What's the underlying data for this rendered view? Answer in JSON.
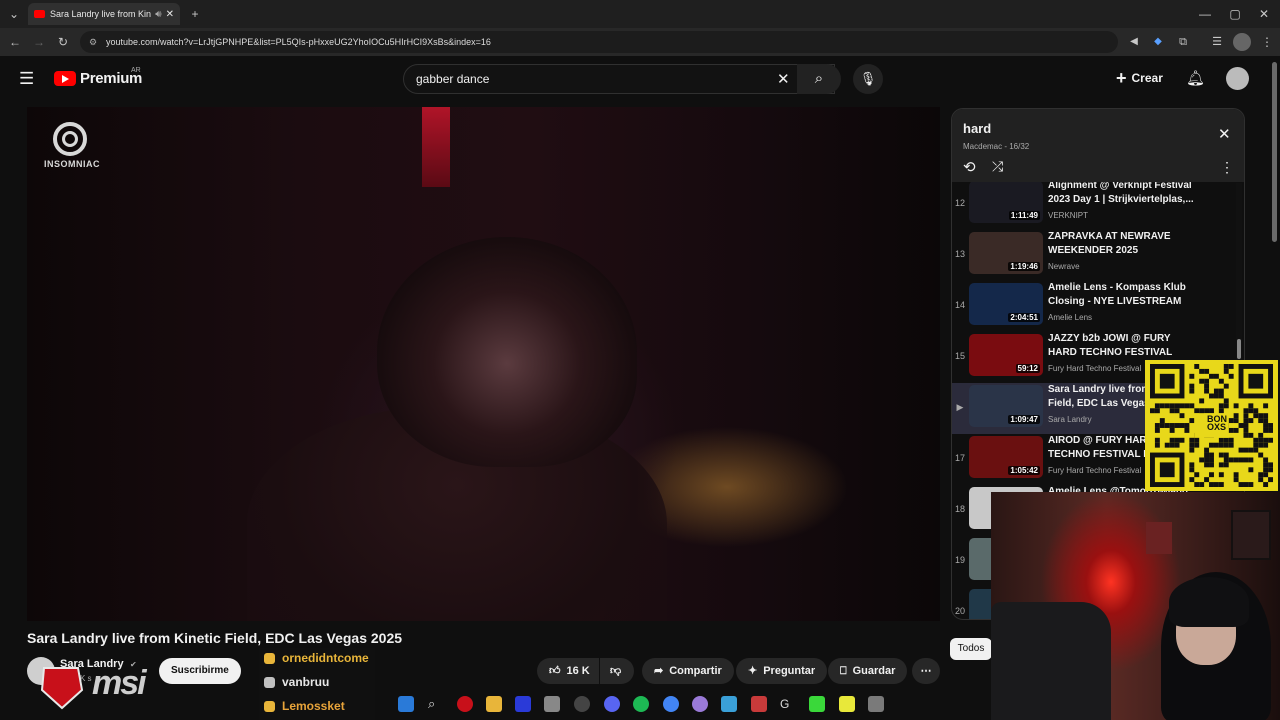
{
  "browser": {
    "tab_title": "Sara Landry live from Kinetic",
    "url": "youtube.com/watch?v=LrJtjGPNHPE&list=PL5QIs-pHxxeUG2YhoIOCu5HIrHCI9XsBs&index=16"
  },
  "youtube": {
    "logo_text": "Premium",
    "region": "AR",
    "search_query": "gabber dance",
    "create_label": "Crear"
  },
  "video": {
    "watermark": "INSOMNIAC",
    "title": "Sara Landry live from Kinetic Field, EDC Las Vegas 2025",
    "channel": "Sara Landry",
    "subscribers_partial": "K s",
    "subscribe_label": "Suscribirme",
    "likes": "16 K",
    "share_label": "Compartir",
    "ask_label": "Preguntar",
    "save_label": "Guardar"
  },
  "playlist": {
    "title": "hard",
    "meta": "Macdemac - 16/32",
    "items": [
      {
        "num": "12",
        "title": "Alignment @ Verknipt Festival 2023 Day 1 | Strijkviertelplas,...",
        "channel": "VERKNIPT",
        "duration": "1:11:49",
        "color": "#1a1a22"
      },
      {
        "num": "13",
        "title": "ZAPRAVKA AT NEWRAVE WEEKENDER 2025",
        "channel": "Newrave",
        "duration": "1:19:46",
        "color": "#3a2a26"
      },
      {
        "num": "14",
        "title": "Amelie Lens - Kompass Klub Closing - NYE LIVESTREAM",
        "channel": "Amelie Lens",
        "duration": "2:04:51",
        "color": "#14284a"
      },
      {
        "num": "15",
        "title": "JAZZY b2b JOWI @ FURY HARD TECHNO FESTIVAL VIII...",
        "channel": "Fury Hard Techno Festival",
        "duration": "59:12",
        "color": "#7a0c10"
      },
      {
        "num": "▶",
        "title": "Sara Landry live from Kinetic Field, EDC Las Vegas",
        "channel": "Sara Landry",
        "duration": "1:09:47",
        "color": "#2a3448"
      },
      {
        "num": "17",
        "title": "AIROD @ FURY HARD TECHNO FESTIVAL III (11/05/2...",
        "channel": "Fury Hard Techno Festival",
        "duration": "1:05:42",
        "color": "#6a1010"
      },
      {
        "num": "18",
        "title": "Amelie Lens @Tomorrowland",
        "channel": "",
        "duration": "",
        "color": "#c8c8c8"
      },
      {
        "num": "19",
        "title": "",
        "channel": "",
        "duration": "",
        "color": "#5a6a6a"
      },
      {
        "num": "20",
        "title": "",
        "channel": "",
        "duration": "",
        "color": "#203848"
      }
    ]
  },
  "overlay": {
    "qr_text": "BON OXS",
    "chat": [
      {
        "name": "ornedidntcome",
        "color": "#e8b53a",
        "badge": "#e8b53a"
      },
      {
        "name": "vanbruu",
        "color": "#e6e6e6",
        "badge": "#c0c0c0"
      },
      {
        "name": "Lemossket",
        "color": "#e8a43a",
        "badge": "#e8b53a"
      }
    ],
    "brand": "msi",
    "chips_label": "Todos"
  }
}
